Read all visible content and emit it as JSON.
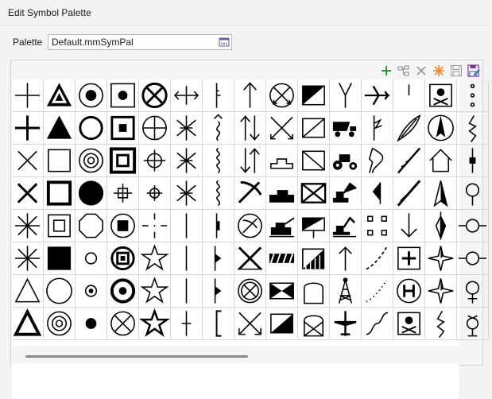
{
  "window": {
    "title": "Edit Symbol Palette"
  },
  "palette": {
    "label": "Palette",
    "value": "Default.mmSymPal",
    "browse_icon": "ellipsis-browse-icon"
  },
  "toolbar": {
    "items": [
      {
        "name": "add-icon",
        "color": "#2e9a3b"
      },
      {
        "name": "group-icon",
        "color": "#8a8a8a"
      },
      {
        "name": "delete-icon",
        "color": "#8a8a8a"
      },
      {
        "name": "asterisk-new-icon",
        "color": "#f08a24"
      },
      {
        "name": "save-icon",
        "color": "#9a9a9a"
      },
      {
        "name": "save-edit-icon",
        "color": "#7b2aa8"
      }
    ]
  },
  "grid": {
    "columns": 15,
    "rows": 8,
    "symbols": [
      [
        "cross",
        "triangle-in-triangle",
        "circle-dot",
        "square-dot",
        "circle-x",
        "arrow-left-right",
        "staff-tick",
        "arrow-up",
        "circle-x-arrows",
        "square-half-fill",
        "y-fork",
        "airplane",
        "tick-small",
        "skull-box",
        "dots-vertical"
      ],
      [
        "cross-bold",
        "triangle-filled",
        "circle-bold",
        "square-bold-dot",
        "circle-plus",
        "star-burst",
        "wavy-arrow",
        "double-arrow-up-down",
        "x-arrows",
        "square-diagonal",
        "dump-truck",
        "lightning-flag",
        "feather",
        "north-arrow-circle",
        "zigzag"
      ],
      [
        "x-mark",
        "square-outline",
        "circle-ring",
        "square-ring",
        "crosshair",
        "star-burst",
        "squiggle",
        "double-arrow-down-up",
        "building-outline",
        "square-diagonal-line",
        "tractor",
        "arrow-flow",
        "feather-line",
        "house-outline",
        "bar-tick"
      ],
      [
        "x-bold",
        "square-bold",
        "circle-filled",
        "small-crosshair",
        "crosshair-small",
        "star-burst",
        "squiggle",
        "pickaxe",
        "building-filled",
        "square-x",
        "excavator",
        "bowtie-half",
        "brush",
        "north-arrow",
        "circle-pin"
      ],
      [
        "asterisk",
        "square-in-square",
        "octagon",
        "circle-square",
        "cross-dashed",
        "vertical-line",
        "staff-filled",
        "circle-pickaxe",
        "tank-flag",
        "flag-square",
        "excavator-small",
        "square-corners",
        "arrow-down-v",
        "north-star",
        "circle-line"
      ],
      [
        "asterisk",
        "square-filled",
        "circle-small",
        "circle-square-bold",
        "star-outline",
        "vertical-line",
        "flag-tri",
        "x-bold-arrows",
        "hatch-bar",
        "hatch-square",
        "arrow-up-v",
        "dashed-curve",
        "plus-box",
        "compass-star",
        "circle-line"
      ],
      [
        "triangle-outline",
        "circle-outline",
        "circle-dot-small",
        "circle-dot-bold",
        "star-outline",
        "vertical-line",
        "flag-tri",
        "circle-x-outline",
        "bowtie",
        "arch",
        "tower",
        "dotted-curve",
        "h-box",
        "compass-star",
        "female"
      ],
      [
        "triangle-bold",
        "circle-ring",
        "dot",
        "circle-x-thin",
        "star-thin",
        "cross-thin",
        "bracket",
        "x-arrows-down",
        "square-half-diag",
        "arch-x",
        "plane-top",
        "curve-s",
        "skull-box",
        "zigzag",
        "circle-pin-top"
      ]
    ]
  }
}
